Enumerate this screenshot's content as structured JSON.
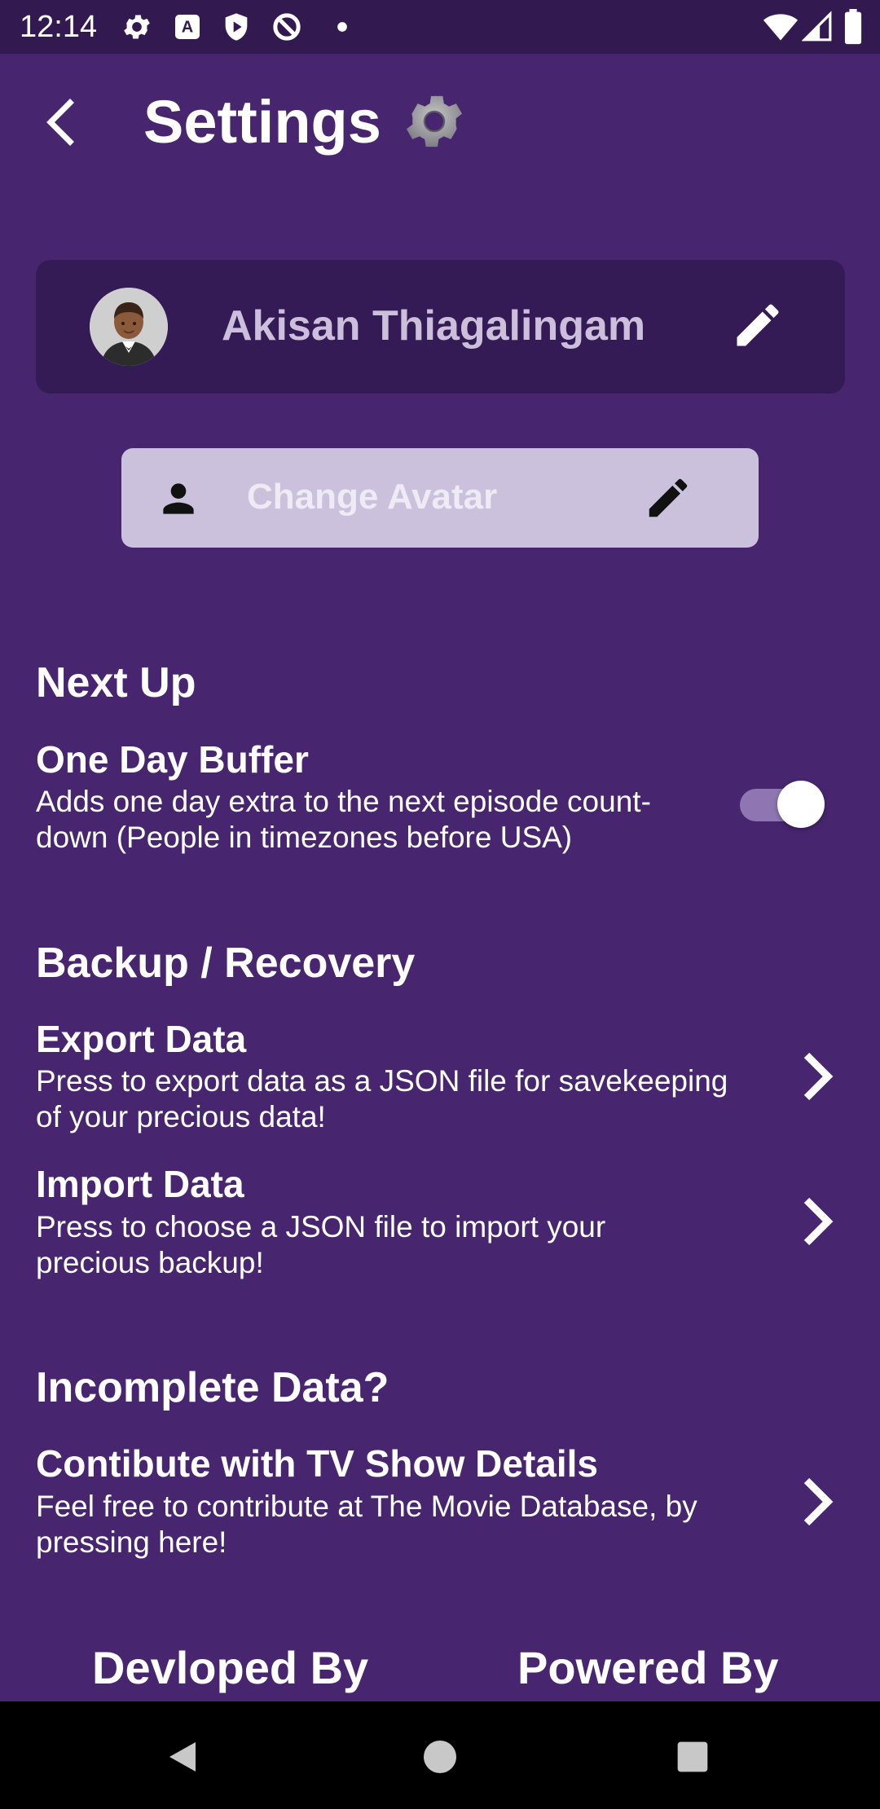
{
  "status_bar": {
    "time": "12:14",
    "left_icons": [
      "gear-icon",
      "font-a-icon",
      "shield-play-icon",
      "circle-slash-icon",
      "dot-icon"
    ],
    "right_icons": [
      "wifi-icon",
      "signal-icon",
      "battery-icon"
    ]
  },
  "header": {
    "title": "Settings",
    "back_icon": "chevron-left-icon",
    "title_icon": "gear-icon"
  },
  "profile": {
    "name": "Akisan Thiagalingam",
    "avatar_icon": "person-avatar-icon",
    "edit_icon": "pencil-icon"
  },
  "change_avatar": {
    "label": "Change Avatar",
    "leading_icon": "person-icon",
    "trailing_icon": "pencil-icon"
  },
  "sections": {
    "next_up": {
      "title": "Next Up",
      "one_day_buffer": {
        "title": "One Day Buffer",
        "desc_line1": "Adds one day extra to the next episode count-",
        "desc_line2": "down (People in timezones before USA)",
        "enabled": true
      }
    },
    "backup": {
      "title": "Backup / Recovery",
      "export": {
        "title": "Export Data",
        "desc_line1": "Press to export data as a JSON file for savekeeping",
        "desc_line2": "of your precious data!"
      },
      "import": {
        "title": "Import Data",
        "desc_line1": "Press to choose a JSON file to import your",
        "desc_line2": "precious backup!"
      }
    },
    "incomplete": {
      "title": "Incomplete Data?",
      "contribute": {
        "title": "Contibute with TV Show Details",
        "desc_line1": "Feel free to contribute at The Movie Database, by",
        "desc_line2": "pressing here!"
      }
    }
  },
  "footer": {
    "developed_by": "Devloped By",
    "powered_by": "Powered By"
  },
  "nav_bar": {
    "buttons": [
      "back-triangle-icon",
      "home-circle-icon",
      "recents-square-icon"
    ]
  },
  "colors": {
    "background": "#47266f",
    "status_bar": "#321a50",
    "card": "#341b55",
    "avatar_button": "#cbc1dc",
    "toggle_track": "#8f76b3"
  }
}
